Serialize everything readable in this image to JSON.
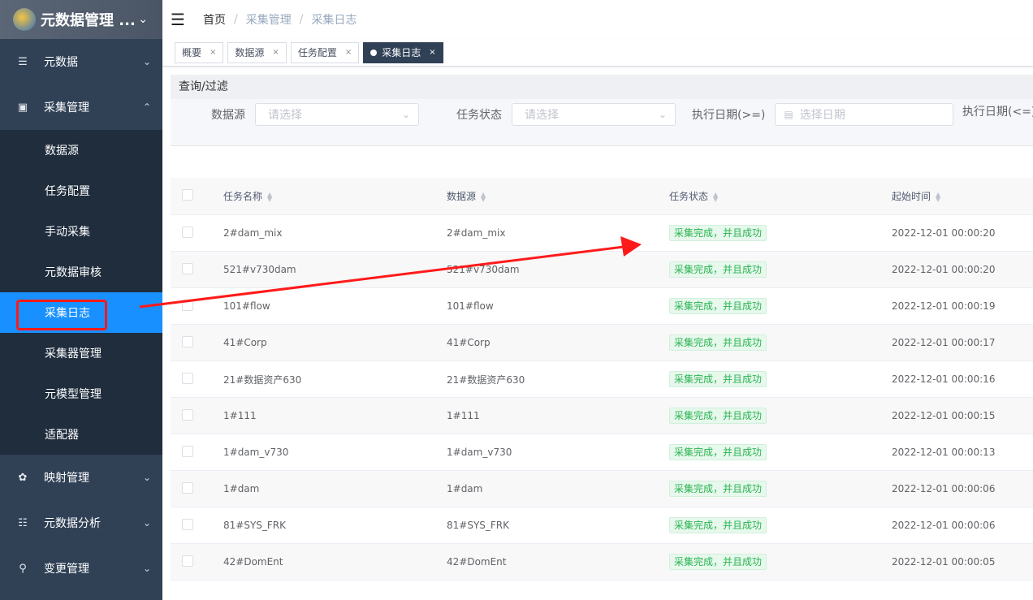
{
  "app": {
    "title": "元数据管理 ..."
  },
  "sidebar": {
    "items": [
      {
        "label": "元数据",
        "icon": "list-icon"
      },
      {
        "label": "采集管理",
        "icon": "inbox-icon"
      },
      {
        "label": "映射管理",
        "icon": "share-icon"
      },
      {
        "label": "元数据分析",
        "icon": "chart-icon"
      },
      {
        "label": "变更管理",
        "icon": "location-icon"
      }
    ],
    "sub_items": [
      "数据源",
      "任务配置",
      "手动采集",
      "元数据审核",
      "采集日志",
      "采集器管理",
      "元模型管理",
      "适配器"
    ]
  },
  "breadcrumb": [
    "首页",
    "采集管理",
    "采集日志"
  ],
  "tags": [
    {
      "label": "概要"
    },
    {
      "label": "数据源"
    },
    {
      "label": "任务配置"
    },
    {
      "label": "采集日志"
    }
  ],
  "filter": {
    "title": "查询/过滤",
    "datasource_label": "数据源",
    "datasource_placeholder": "请选择",
    "status_label": "任务状态",
    "status_placeholder": "请选择",
    "date_from_label": "执行日期(>=)",
    "date_from_placeholder": "选择日期",
    "date_to_label": "执行日期(<=)"
  },
  "table": {
    "columns": [
      "任务名称",
      "数据源",
      "任务状态",
      "起始时间"
    ],
    "rows": [
      {
        "name": "2#dam_mix",
        "source": "2#dam_mix",
        "status": "采集完成，并且成功",
        "start": "2022-12-01 00:00:20"
      },
      {
        "name": "521#v730dam",
        "source": "521#v730dam",
        "status": "采集完成，并且成功",
        "start": "2022-12-01 00:00:20"
      },
      {
        "name": "101#flow",
        "source": "101#flow",
        "status": "采集完成，并且成功",
        "start": "2022-12-01 00:00:19"
      },
      {
        "name": "41#Corp",
        "source": "41#Corp",
        "status": "采集完成，并且成功",
        "start": "2022-12-01 00:00:17"
      },
      {
        "name": "21#数据资产630",
        "source": "21#数据资产630",
        "status": "采集完成，并且成功",
        "start": "2022-12-01 00:00:16"
      },
      {
        "name": "1#111",
        "source": "1#111",
        "status": "采集完成，并且成功",
        "start": "2022-12-01 00:00:15"
      },
      {
        "name": "1#dam_v730",
        "source": "1#dam_v730",
        "status": "采集完成，并且成功",
        "start": "2022-12-01 00:00:13"
      },
      {
        "name": "1#dam",
        "source": "1#dam",
        "status": "采集完成，并且成功",
        "start": "2022-12-01 00:00:06"
      },
      {
        "name": "81#SYS_FRK",
        "source": "81#SYS_FRK",
        "status": "采集完成，并且成功",
        "start": "2022-12-01 00:00:06"
      },
      {
        "name": "42#DomEnt",
        "source": "42#DomEnt",
        "status": "采集完成，并且成功",
        "start": "2022-12-01 00:00:05"
      }
    ]
  },
  "colors": {
    "sidebar_bg": "#304156",
    "active_menu": "#1890ff",
    "highlight": "#ff1a1a",
    "status_green": "#29b44f"
  }
}
